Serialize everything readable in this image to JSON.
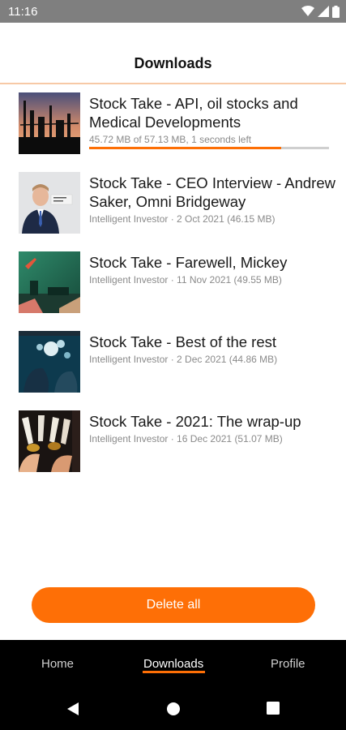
{
  "status_bar": {
    "time": "11:16"
  },
  "header": {
    "title": "Downloads"
  },
  "downloads": [
    {
      "title": "Stock Take - API, oil stocks and Medical Developments",
      "meta": "45.72 MB of 57.13 MB, 1 seconds left",
      "progress": 0.8,
      "thumb": "oil-refinery-image"
    },
    {
      "title": "Stock Take - CEO Interview - Andrew Saker, Omni Bridgeway",
      "meta": "Intelligent Investor · 2 Oct 2021 (46.15 MB)",
      "thumb": "ceo-portrait-image"
    },
    {
      "title": "Stock Take - Farewell, Mickey",
      "meta": "Intelligent Investor · 11 Nov 2021 (49.55 MB)",
      "thumb": "green-scene-image"
    },
    {
      "title": "Stock Take - Best of the rest",
      "meta": "Intelligent Investor · 2 Dec 2021 (44.86 MB)",
      "thumb": "lights-scene-image"
    },
    {
      "title": "Stock Take - 2021: The wrap-up",
      "meta": "Intelligent Investor · 16 Dec 2021 (51.07 MB)",
      "thumb": "champagne-toast-image"
    }
  ],
  "actions": {
    "delete_all": "Delete all"
  },
  "bottom_nav": {
    "items": [
      {
        "label": "Home"
      },
      {
        "label": "Downloads"
      },
      {
        "label": "Profile"
      }
    ],
    "active": "Downloads"
  },
  "colors": {
    "accent": "#fe6f06",
    "status_bar": "#7f7f7f"
  }
}
